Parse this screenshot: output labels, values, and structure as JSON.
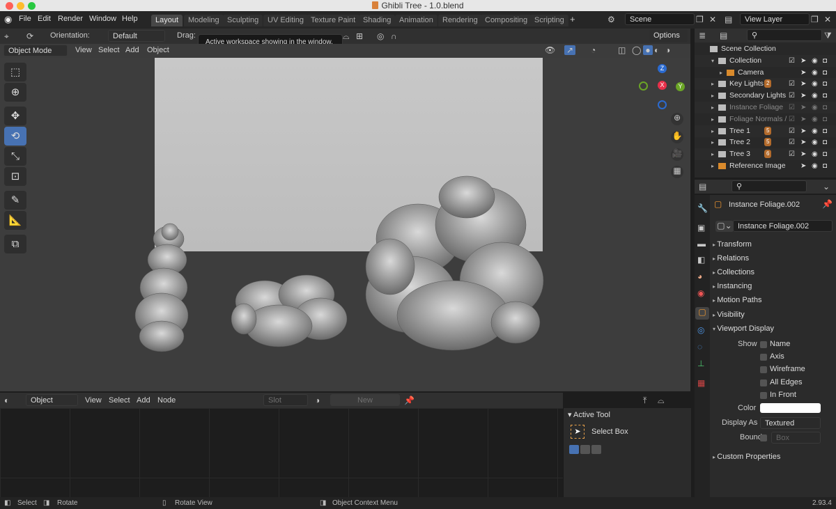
{
  "window": {
    "title": "Ghibli Tree - 1.0.blend"
  },
  "menu": [
    "File",
    "Edit",
    "Render",
    "Window",
    "Help"
  ],
  "workspaces": [
    {
      "label": "Layout",
      "active": true
    },
    {
      "label": "Modeling"
    },
    {
      "label": "Sculpting"
    },
    {
      "label": "UV Editing"
    },
    {
      "label": "Texture Paint"
    },
    {
      "label": "Shading"
    },
    {
      "label": "Animation"
    },
    {
      "label": "Rendering"
    },
    {
      "label": "Compositing"
    },
    {
      "label": "Scripting"
    }
  ],
  "scene": {
    "name": "Scene",
    "view_layer": "View Layer"
  },
  "tooltip": "Active workspace showing in the window.",
  "tool_header": {
    "orientation_label": "Orientation:",
    "orientation_value": "Default",
    "drag_label": "Drag:",
    "options": "Options"
  },
  "viewport_header": {
    "mode": "Object Mode",
    "menus": [
      "View",
      "Select",
      "Add",
      "Object"
    ]
  },
  "gizmo": {
    "z": "Z",
    "x": "X",
    "y": "Y"
  },
  "toolbar_icons": [
    "select-box-icon",
    "cursor-icon",
    "move-icon",
    "rotate-icon",
    "scale-icon",
    "transform-icon",
    "annotate-icon",
    "measure-icon",
    "add-cube-icon"
  ],
  "shader_header": {
    "editor_type": "Object",
    "menus": [
      "View",
      "Select",
      "Add",
      "Node"
    ],
    "slot": "Slot",
    "new": "New"
  },
  "active_tool": {
    "title": "Active Tool",
    "name": "Select Box"
  },
  "outliner": {
    "rows": [
      {
        "label": "Scene Collection",
        "indent": 0,
        "dim": false
      },
      {
        "label": "Collection",
        "indent": 1,
        "dim": false
      },
      {
        "label": "Camera",
        "indent": 2,
        "dim": false
      },
      {
        "label": "Key Lights",
        "indent": 1,
        "dim": false,
        "badge": "2"
      },
      {
        "label": "Secondary Lights",
        "indent": 1,
        "dim": false
      },
      {
        "label": "Instance Foliage",
        "indent": 1,
        "dim": true
      },
      {
        "label": "Foliage Normals /",
        "indent": 1,
        "dim": true
      },
      {
        "label": "Tree 1",
        "indent": 1,
        "dim": false,
        "badge": "5"
      },
      {
        "label": "Tree 2",
        "indent": 1,
        "dim": false,
        "badge": "5"
      },
      {
        "label": "Tree 3",
        "indent": 1,
        "dim": false,
        "badge": "6"
      },
      {
        "label": "Reference Image",
        "indent": 1,
        "dim": false
      }
    ]
  },
  "properties": {
    "object_name": "Instance Foliage.002",
    "data_name": "Instance Foliage.002",
    "panels": [
      "Transform",
      "Relations",
      "Collections",
      "Instancing",
      "Motion Paths",
      "Visibility"
    ],
    "viewport_display": {
      "title": "Viewport Display",
      "show_label": "Show",
      "options": [
        "Name",
        "Axis",
        "Wireframe",
        "All Edges",
        "In Front"
      ],
      "color_label": "Color",
      "color_value": "#ffffff",
      "display_as_label": "Display As",
      "display_as_value": "Textured",
      "bounds_label": "Bounds",
      "bounds_value": "Box"
    },
    "custom_properties": "Custom Properties"
  },
  "status": {
    "select": "Select",
    "rotate": "Rotate",
    "rotate_view": "Rotate View",
    "context_menu": "Object Context Menu",
    "version": "2.93.4"
  }
}
